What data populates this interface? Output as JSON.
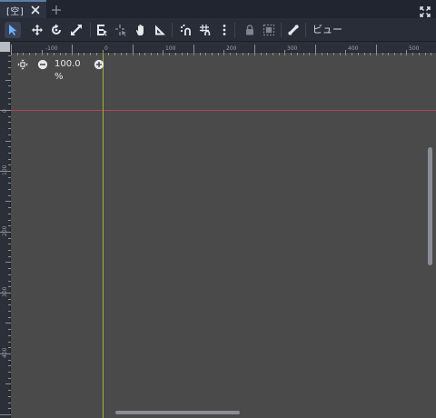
{
  "tab": {
    "label": "[空]"
  },
  "toolbar": {
    "view_label": "ビュー"
  },
  "zoom": {
    "level": "100.0 %"
  },
  "ruler": {
    "top_labels": [
      "-100",
      "0",
      "100",
      "200",
      "300",
      "400",
      "500"
    ],
    "left_labels": [
      "0",
      "100",
      "200",
      "300",
      "400"
    ]
  }
}
